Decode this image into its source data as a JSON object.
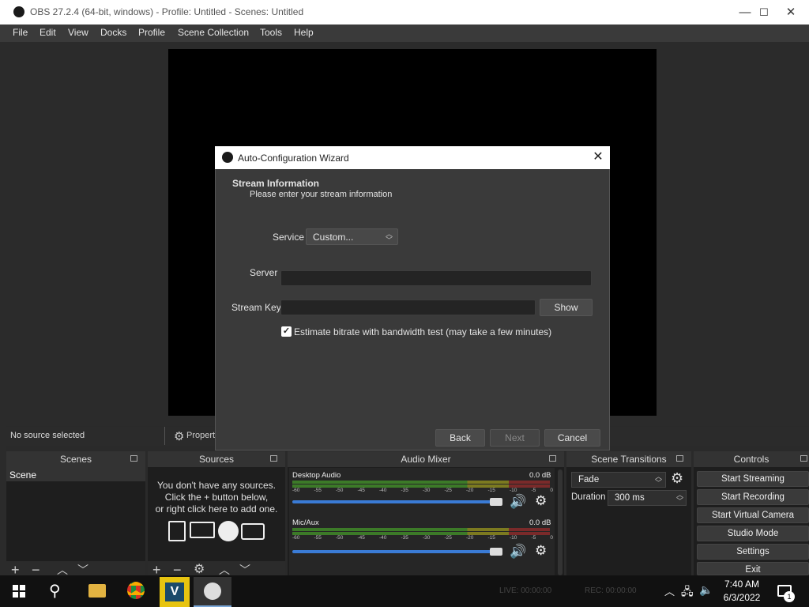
{
  "window": {
    "title": "OBS 27.2.4 (64-bit, windows) - Profile: Untitled - Scenes: Untitled",
    "min": "—",
    "max": "☐",
    "close": "✕"
  },
  "menu": [
    "File",
    "Edit",
    "View",
    "Docks",
    "Profile",
    "Scene Collection",
    "Tools",
    "Help"
  ],
  "status": {
    "no_source": "No source selected",
    "properties": "Propert"
  },
  "docks": {
    "scenes": "Scenes",
    "sources": "Sources",
    "mixer": "Audio Mixer",
    "transitions": "Scene Transitions",
    "controls": "Controls"
  },
  "scenes": {
    "items": [
      "Scene"
    ]
  },
  "sources": {
    "empty_1": "You don't have any sources.",
    "empty_2": "Click the + button below,",
    "empty_3": "or right click here to add one."
  },
  "mixer": {
    "scale": [
      "-60",
      "-55",
      "-50",
      "-45",
      "-40",
      "-35",
      "-30",
      "-25",
      "-20",
      "-15",
      "-10",
      "-5",
      "0"
    ],
    "channels": [
      {
        "name": "Desktop Audio",
        "db": "0.0 dB"
      },
      {
        "name": "Mic/Aux",
        "db": "0.0 dB"
      }
    ]
  },
  "transitions": {
    "selected": "Fade",
    "duration_label": "Duration",
    "duration": "300 ms"
  },
  "controls": [
    "Start Streaming",
    "Start Recording",
    "Start Virtual Camera",
    "Studio Mode",
    "Settings",
    "Exit"
  ],
  "dialog": {
    "title": "Auto-Configuration Wizard",
    "heading": "Stream Information",
    "subheading": "Please enter your stream information",
    "service_label": "Service",
    "service_value": "Custom...",
    "server_label": "Server",
    "server_value": "",
    "key_label": "Stream Key",
    "key_value": "",
    "show": "Show",
    "checkbox_label": "Estimate bitrate with bandwidth test (may take a few minutes)",
    "checkbox_checked": true,
    "back": "Back",
    "next": "Next",
    "cancel": "Cancel"
  },
  "taskbar": {
    "live": "LIVE: 00:00:00",
    "rec": "REC: 00:00:00",
    "time": "7:40 AM",
    "date": "6/3/2022",
    "notif_count": "1"
  }
}
